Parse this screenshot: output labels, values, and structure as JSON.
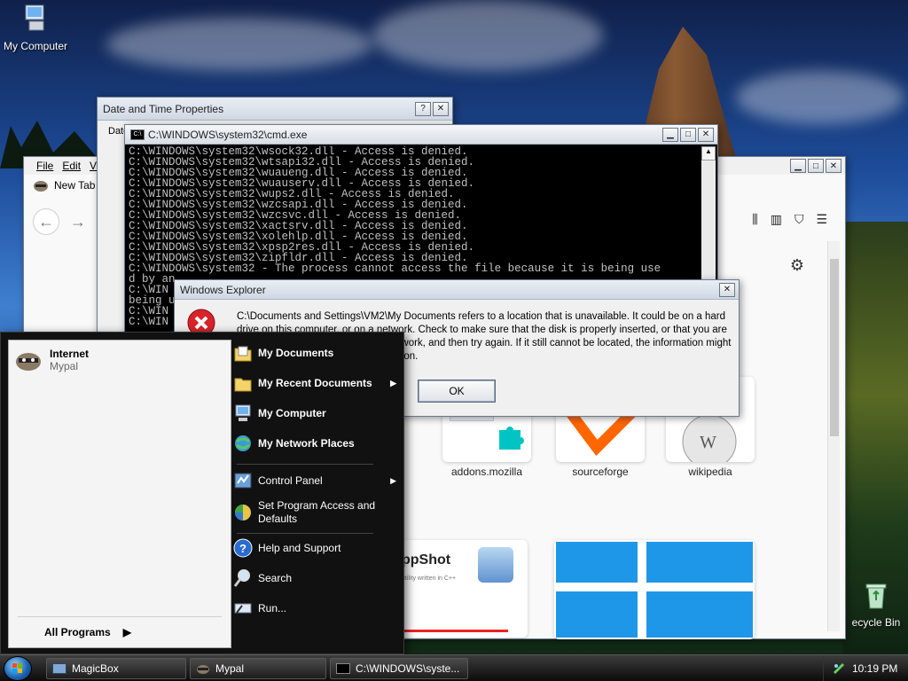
{
  "desktop": {
    "icons": [
      {
        "label": "My Computer"
      },
      {
        "label": "ecycle Bin"
      }
    ]
  },
  "firefox": {
    "menu": [
      "File",
      "Edit",
      "V"
    ],
    "tab_label": "New Tab",
    "tiles": [
      {
        "label": "addons.mozilla"
      },
      {
        "label": "sourceforge"
      },
      {
        "label": "wikipedia"
      }
    ],
    "appshot_title": "ppShot",
    "appshot_sub": "utility written in C++"
  },
  "datetime": {
    "title": "Date and Time Properties",
    "tab_partial": "Date"
  },
  "cmd": {
    "title": "C:\\WINDOWS\\system32\\cmd.exe",
    "lines": [
      "C:\\WINDOWS\\system32\\wsock32.dll - Access is denied.",
      "C:\\WINDOWS\\system32\\wtsapi32.dll - Access is denied.",
      "C:\\WINDOWS\\system32\\wuaueng.dll - Access is denied.",
      "C:\\WINDOWS\\system32\\wuauserv.dll - Access is denied.",
      "C:\\WINDOWS\\system32\\wups2.dll - Access is denied.",
      "C:\\WINDOWS\\system32\\wzcsapi.dll - Access is denied.",
      "C:\\WINDOWS\\system32\\wzcsvc.dll - Access is denied.",
      "C:\\WINDOWS\\system32\\xactsrv.dll - Access is denied.",
      "C:\\WINDOWS\\system32\\xolehlp.dll - Access is denied.",
      "C:\\WINDOWS\\system32\\xpsp2res.dll - Access is denied.",
      "C:\\WINDOWS\\system32\\zipfldr.dll - Access is denied.",
      "C:\\WINDOWS\\system32 - The process cannot access the file because it is being use",
      "d by an",
      "C:\\WIN",
      "being u",
      "C:\\WIN",
      "C:\\WIN"
    ]
  },
  "dialog": {
    "title": "Windows Explorer",
    "message": "C:\\Documents and Settings\\VM2\\My Documents refers to a location that is unavailable. It could be on a hard drive on this computer, or on a network. Check to make sure that the disk is properly inserted, or that you are connected to the Internet or your network, and then try again. If it still cannot be located, the information might have been moved to a different location.",
    "ok_label": "OK"
  },
  "start_menu": {
    "pinned_title": "Internet",
    "pinned_sub": "Mypal",
    "all_programs": "All Programs",
    "right_items": [
      {
        "label": "My Documents"
      },
      {
        "label": "My Recent Documents"
      },
      {
        "label": "My Computer"
      },
      {
        "label": "My Network Places"
      },
      {
        "label": "Control Panel"
      },
      {
        "label": "Set Program Access and Defaults"
      },
      {
        "label": "Help and Support"
      },
      {
        "label": "Search"
      },
      {
        "label": "Run..."
      }
    ]
  },
  "taskbar": {
    "tasks": [
      {
        "label": "MagicBox"
      },
      {
        "label": "Mypal"
      },
      {
        "label": "C:\\WINDOWS\\syste..."
      }
    ],
    "clock": "10:19 PM"
  }
}
